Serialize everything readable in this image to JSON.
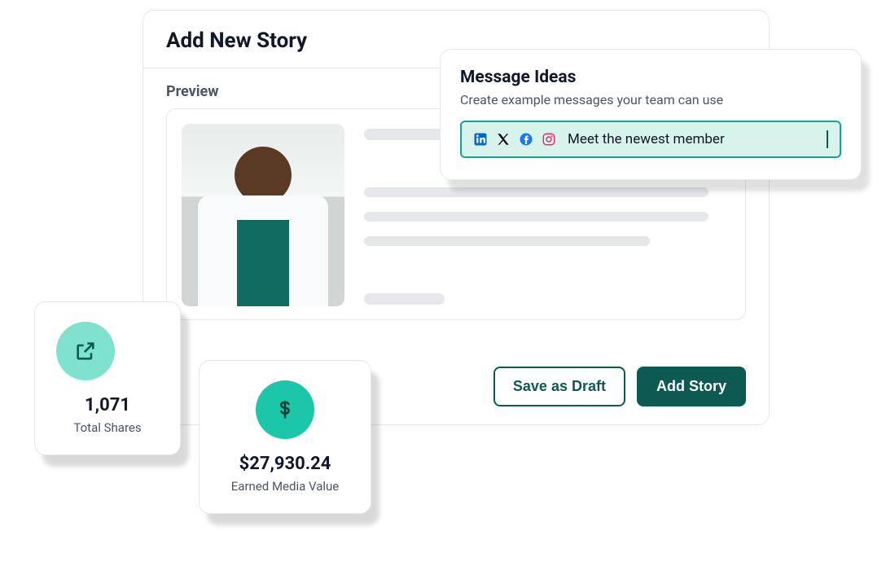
{
  "story": {
    "title": "Add New Story",
    "previewLabel": "Preview",
    "buttons": {
      "saveDraft": "Save as Draft",
      "addStory": "Add Story"
    }
  },
  "messageIdeas": {
    "title": "Message Ideas",
    "subtitle": "Create example messages your team can use",
    "inputValue": "Meet the newest member",
    "socialIcons": [
      "linkedin-icon",
      "x-icon",
      "facebook-icon",
      "instagram-icon"
    ]
  },
  "stats": {
    "shares": {
      "value": "1,071",
      "label": "Total Shares",
      "icon": "share-external-icon"
    },
    "emv": {
      "value": "$27,930.24",
      "label": "Earned Media Value",
      "icon": "dollar-icon"
    }
  },
  "colors": {
    "accent": "#0d5a53",
    "accentLight": "#1bc6a9",
    "accentPale": "#7ee2cf",
    "inputBg": "#d8f3ec"
  }
}
